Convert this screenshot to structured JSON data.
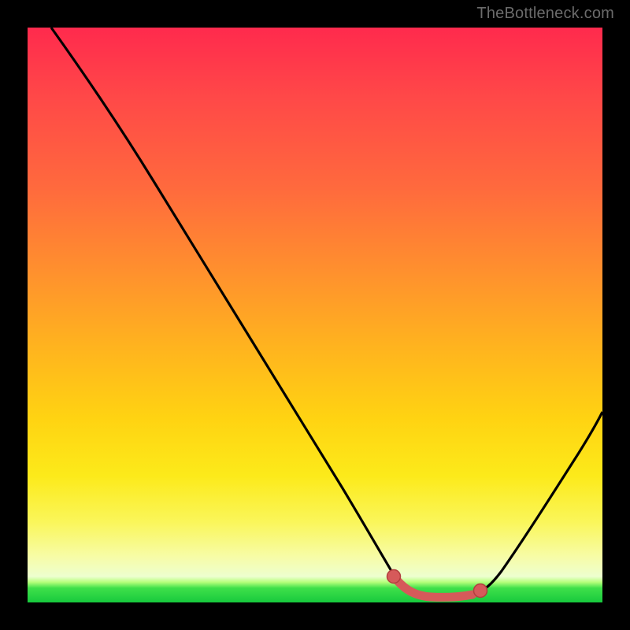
{
  "watermark": "TheBottleneck.com",
  "colors": {
    "background": "#000000",
    "curve_stroke": "#000000",
    "marker_fill": "#d65a5a",
    "marker_stroke": "#b23e3e"
  },
  "chart_data": {
    "type": "line",
    "title": "",
    "xlabel": "",
    "ylabel": "",
    "xlim": [
      0,
      100
    ],
    "ylim": [
      0,
      100
    ],
    "grid": false,
    "series": [
      {
        "name": "bottleneck-curve",
        "x": [
          4,
          10,
          16,
          22,
          28,
          34,
          40,
          46,
          52,
          58,
          60,
          63,
          66,
          69,
          72,
          75,
          78,
          82,
          88,
          94,
          100
        ],
        "y": [
          100,
          92,
          83,
          74,
          65,
          56,
          47,
          38,
          29,
          17,
          12,
          6,
          3,
          1.5,
          1,
          1,
          1.5,
          3.5,
          11,
          22,
          35
        ]
      }
    ],
    "markers": [
      {
        "name": "optimal-start",
        "x": 63,
        "y": 3
      },
      {
        "name": "optimal-end",
        "x": 78,
        "y": 3
      }
    ],
    "optimal_segment": {
      "x_start": 63,
      "x_end": 78,
      "y": 1.5
    }
  }
}
